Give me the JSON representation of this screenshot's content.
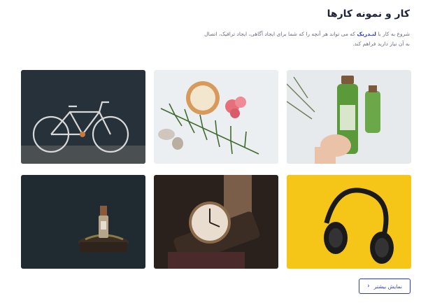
{
  "section": {
    "title": "کار و نمونه کارها",
    "description_before": "شروع به کار با ",
    "brand": "لنـدریک",
    "description_after": " که می تواند هر آنچه را که شما برای ایجاد آگاهی، ایجاد ترافیک، اتصال به آن نیاز دارید فراهم کند.",
    "brand_color": "#2c3cc4"
  },
  "gallery": {
    "items": [
      {
        "subject": "bicycle"
      },
      {
        "subject": "cosmetic-jar-with-leaves-and-flowers"
      },
      {
        "subject": "hand-holding-green-bottles"
      },
      {
        "subject": "perfume-bottle-on-stand"
      },
      {
        "subject": "wrist-watch"
      },
      {
        "subject": "headphones-on-yellow"
      }
    ]
  },
  "more_button": {
    "label": "نمایش بیشتر",
    "icon": "chevron-left-icon"
  }
}
